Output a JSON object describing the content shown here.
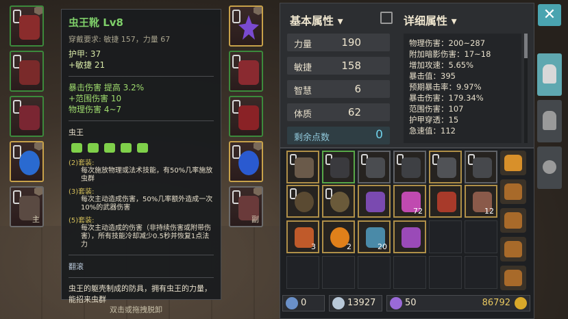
{
  "tooltip": {
    "title": "虫王靴 Lv8",
    "requirement": "穿戴要求:   敏捷 157，力量 67",
    "base_stats": [
      "护甲:  37",
      "+敏捷 21"
    ],
    "extra_stats": [
      "暴击伤害 提高 3.2%",
      "+范围伤害 10",
      "物理伤害 4~7"
    ],
    "set_name": "虫王",
    "set_bonuses": [
      {
        "head": "(2)套装:",
        "desc": "每次施放物理或法术技能，有50%几率施放虫群"
      },
      {
        "head": "(3)套装:",
        "desc": "每次主动造成伤害，50%几率额外造成一次10%的武器伤害"
      },
      {
        "head": "(5)套装:",
        "desc": "每次主动造成的伤害（非持续伤害或附带伤害），所有技能冷却减少0.5秒并恢复1点法力"
      }
    ],
    "skill": "翻滚",
    "description": "虫王的躯壳制成的防具，拥有虫王的力量，能招来虫群"
  },
  "bottom_hint": "双击或拖拽脱卸",
  "slot_tags": {
    "main": "主",
    "sub": "副"
  },
  "basic_attributes": {
    "title": "基本属性",
    "rows": [
      {
        "label": "力量",
        "value": "190"
      },
      {
        "label": "敏捷",
        "value": "158"
      },
      {
        "label": "智慧",
        "value": "6"
      },
      {
        "label": "体质",
        "value": "62"
      }
    ],
    "points_label": "剩余点数",
    "points_value": "0"
  },
  "detailed_attributes": {
    "title": "详细属性",
    "lines": [
      "物理伤害：200~287",
      "附加暗影伤害：17~18",
      "增加攻速：5.65%",
      "暴击值：395",
      "预期暴击率：9.97%",
      "暴击伤害：179.34%",
      "范围伤害：107",
      "护甲穿透：15",
      "急速值：112"
    ]
  },
  "inventory_counts": {
    "gem_pink": "72",
    "helmet_horns": "12",
    "flower": "3",
    "pumpkin": "2",
    "scroll": "20"
  },
  "currency": {
    "arrows": "0",
    "gear": "13927",
    "crystal": "50",
    "gold": "86792"
  },
  "close_label": "✕",
  "colors": {
    "accent": "#5fa8b0",
    "green_text": "#7fd06a",
    "gold_border": "#b09048"
  }
}
